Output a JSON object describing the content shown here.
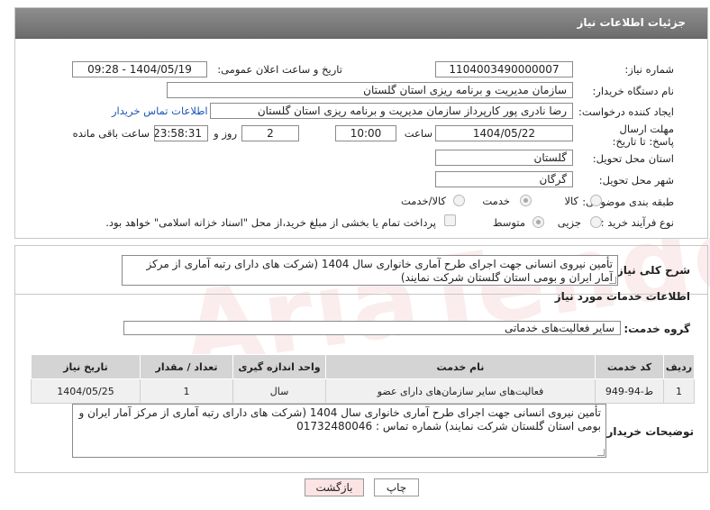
{
  "panel": {
    "title": "جزئیات اطلاعات نیاز"
  },
  "fields": {
    "need_number": {
      "label": "شماره نیاز:",
      "value": "1104003490000007"
    },
    "announce_datetime": {
      "label": "تاریخ و ساعت اعلان عمومی:",
      "value": "1404/05/19 - 09:28"
    },
    "buyer_org": {
      "label": "نام دستگاه خریدار:",
      "value": "سازمان مدیریت و برنامه ریزی استان گلستان"
    },
    "requester": {
      "label": "ایجاد کننده درخواست:",
      "value": "رضا  نادری پور کارپرداز سازمان مدیریت و برنامه ریزی استان گلستان",
      "contact_link": "اطلاعات تماس خریدار"
    },
    "deadline": {
      "label": "مهلت ارسال پاسخ: تا تاریخ:",
      "date": "1404/05/22",
      "time_label": "ساعت",
      "time": "10:00",
      "days": "2",
      "days_label": "روز و",
      "remaining": "23:58:31",
      "remaining_label": "ساعت باقی مانده"
    },
    "province": {
      "label": "استان محل تحویل:",
      "value": "گلستان"
    },
    "city": {
      "label": "شهر محل تحویل:",
      "value": "گرگان"
    },
    "category": {
      "label": "طبقه بندی موضوعی:",
      "options": [
        "کالا",
        "خدمت",
        "کالا/خدمت"
      ],
      "selected": "خدمت"
    },
    "purchase_type": {
      "label": "نوع فرآیند خرید :",
      "options": [
        "جزیی",
        "متوسط"
      ],
      "selected": "متوسط",
      "payment_note": "پرداخت تمام یا بخشی از مبلغ خرید،از محل \"اسناد خزانه اسلامی\" خواهد بود."
    }
  },
  "summary": {
    "label": "شرح کلی نیاز:",
    "text": "تأمین نیروی انسانی جهت اجرای طرح آماری خانواری سال 1404 (شرکت های دارای رتبه آماری از مرکز آمار ایران و بومی استان گلستان شرکت نمایند)"
  },
  "services": {
    "title": "اطلاعات خدمات مورد نیاز",
    "group_label": "گروه خدمت:",
    "group_value": "سایر فعالیت‌های خدماتی",
    "columns": [
      "ردیف",
      "کد خدمت",
      "نام خدمت",
      "واحد اندازه گیری",
      "تعداد / مقدار",
      "تاریخ نیاز"
    ],
    "rows": [
      {
        "row": "1",
        "code": "ط-94-949",
        "name": "فعالیت‌های سایر سازمان‌های دارای عضو",
        "unit": "سال",
        "qty": "1",
        "date": "1404/05/25"
      }
    ]
  },
  "buyer_notes": {
    "label": "توضیحات خریدار:",
    "text": "تأمین نیروی انسانی جهت اجرای طرح آماری خانواری سال 1404 (شرکت های دارای رتبه آماری از مرکز آمار ایران و بومی استان گلستان شرکت نمایند) شماره تماس : 01732480046"
  },
  "buttons": {
    "print": "چاپ",
    "back": "بازگشت"
  },
  "watermark": "AriaTender.neT",
  "colors": {
    "header_bg": "#7d7d7d",
    "link": "#1a55b8",
    "back_button_bg": "#fce4e4",
    "watermark": "#e88c8c"
  }
}
